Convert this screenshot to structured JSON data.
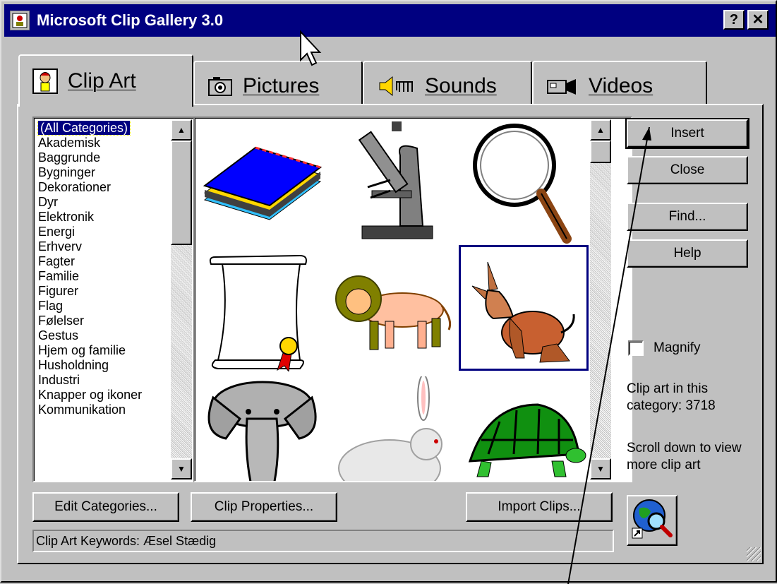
{
  "window": {
    "title": "Microsoft Clip Gallery 3.0",
    "help_btn": "?",
    "close_btn": "✕"
  },
  "tabs": [
    {
      "label": "Clip Art",
      "icon": "clip-art-icon",
      "active": true
    },
    {
      "label": "Pictures",
      "icon": "camera-icon",
      "active": false
    },
    {
      "label": "Sounds",
      "icon": "speaker-icon",
      "active": false
    },
    {
      "label": "Videos",
      "icon": "video-camera-icon",
      "active": false
    }
  ],
  "categories": [
    "(All Categories)",
    "Akademisk",
    "Baggrunde",
    "Bygninger",
    "Dekorationer",
    "Dyr",
    "Elektronik",
    "Energi",
    "Erhverv",
    "Fagter",
    "Familie",
    "Figurer",
    "Flag",
    "Følelser",
    "Gestus",
    "Hjem og familie",
    "Husholdning",
    "Industri",
    "Knapper og ikoner",
    "Kommunikation"
  ],
  "selected_category": "(All Categories)",
  "clips": [
    {
      "name": "book-clip"
    },
    {
      "name": "microscope-clip"
    },
    {
      "name": "magnifier-clip"
    },
    {
      "name": "scroll-clip"
    },
    {
      "name": "lion-clip"
    },
    {
      "name": "donkey-clip",
      "selected": true
    },
    {
      "name": "elephant-clip"
    },
    {
      "name": "rabbit-clip"
    },
    {
      "name": "turtle-clip"
    }
  ],
  "buttons": {
    "insert": "Insert",
    "close": "Close",
    "find": "Find...",
    "help": "Help",
    "edit_categories": "Edit Categories...",
    "clip_properties": "Clip Properties...",
    "import_clips": "Import Clips..."
  },
  "magnify": {
    "label": "Magnify",
    "checked": false
  },
  "info": {
    "count_line1": "Clip art in this",
    "count_line2": "category: 3718",
    "scroll_line1": "Scroll down to view",
    "scroll_line2": "more clip art"
  },
  "status": {
    "keywords": "Clip Art Keywords:   Æsel Stædig"
  },
  "colors": {
    "face": "#c0c0c0",
    "title_bg": "#000080",
    "selection": "#000080"
  }
}
